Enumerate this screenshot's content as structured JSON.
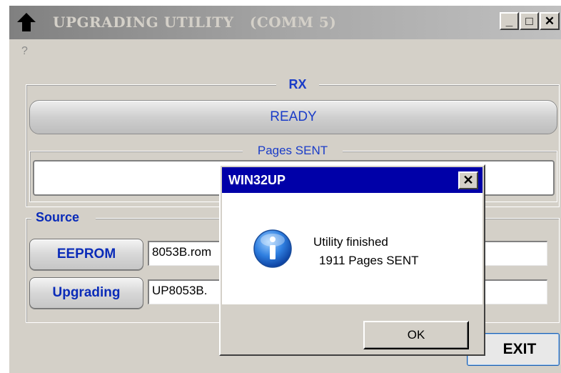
{
  "window": {
    "title": "UPGRADING UTILITY   (COMM 5)",
    "minimize_label": "_",
    "maximize_label": "□",
    "close_label": "✕",
    "menu_help": "?"
  },
  "rx_group": {
    "legend": "RX",
    "status": "READY"
  },
  "pages_group": {
    "legend": "Pages SENT",
    "value": ""
  },
  "source_group": {
    "legend": "Source",
    "eeprom_button": "EEPROM",
    "eeprom_file": "8053B.rom",
    "upgrading_button": "Upgrading",
    "upgrading_file": "UP8053B."
  },
  "exit_button": "EXIT",
  "dialog": {
    "title": "WIN32UP",
    "close_label": "✕",
    "icon": "info-icon",
    "line1": "Utility finished",
    "line2": "1911 Pages SENT",
    "ok_button": "OK"
  },
  "colors": {
    "dialog_title": "#0000a8",
    "accent_text": "#1a3cc8",
    "face": "#d4d0c8"
  }
}
